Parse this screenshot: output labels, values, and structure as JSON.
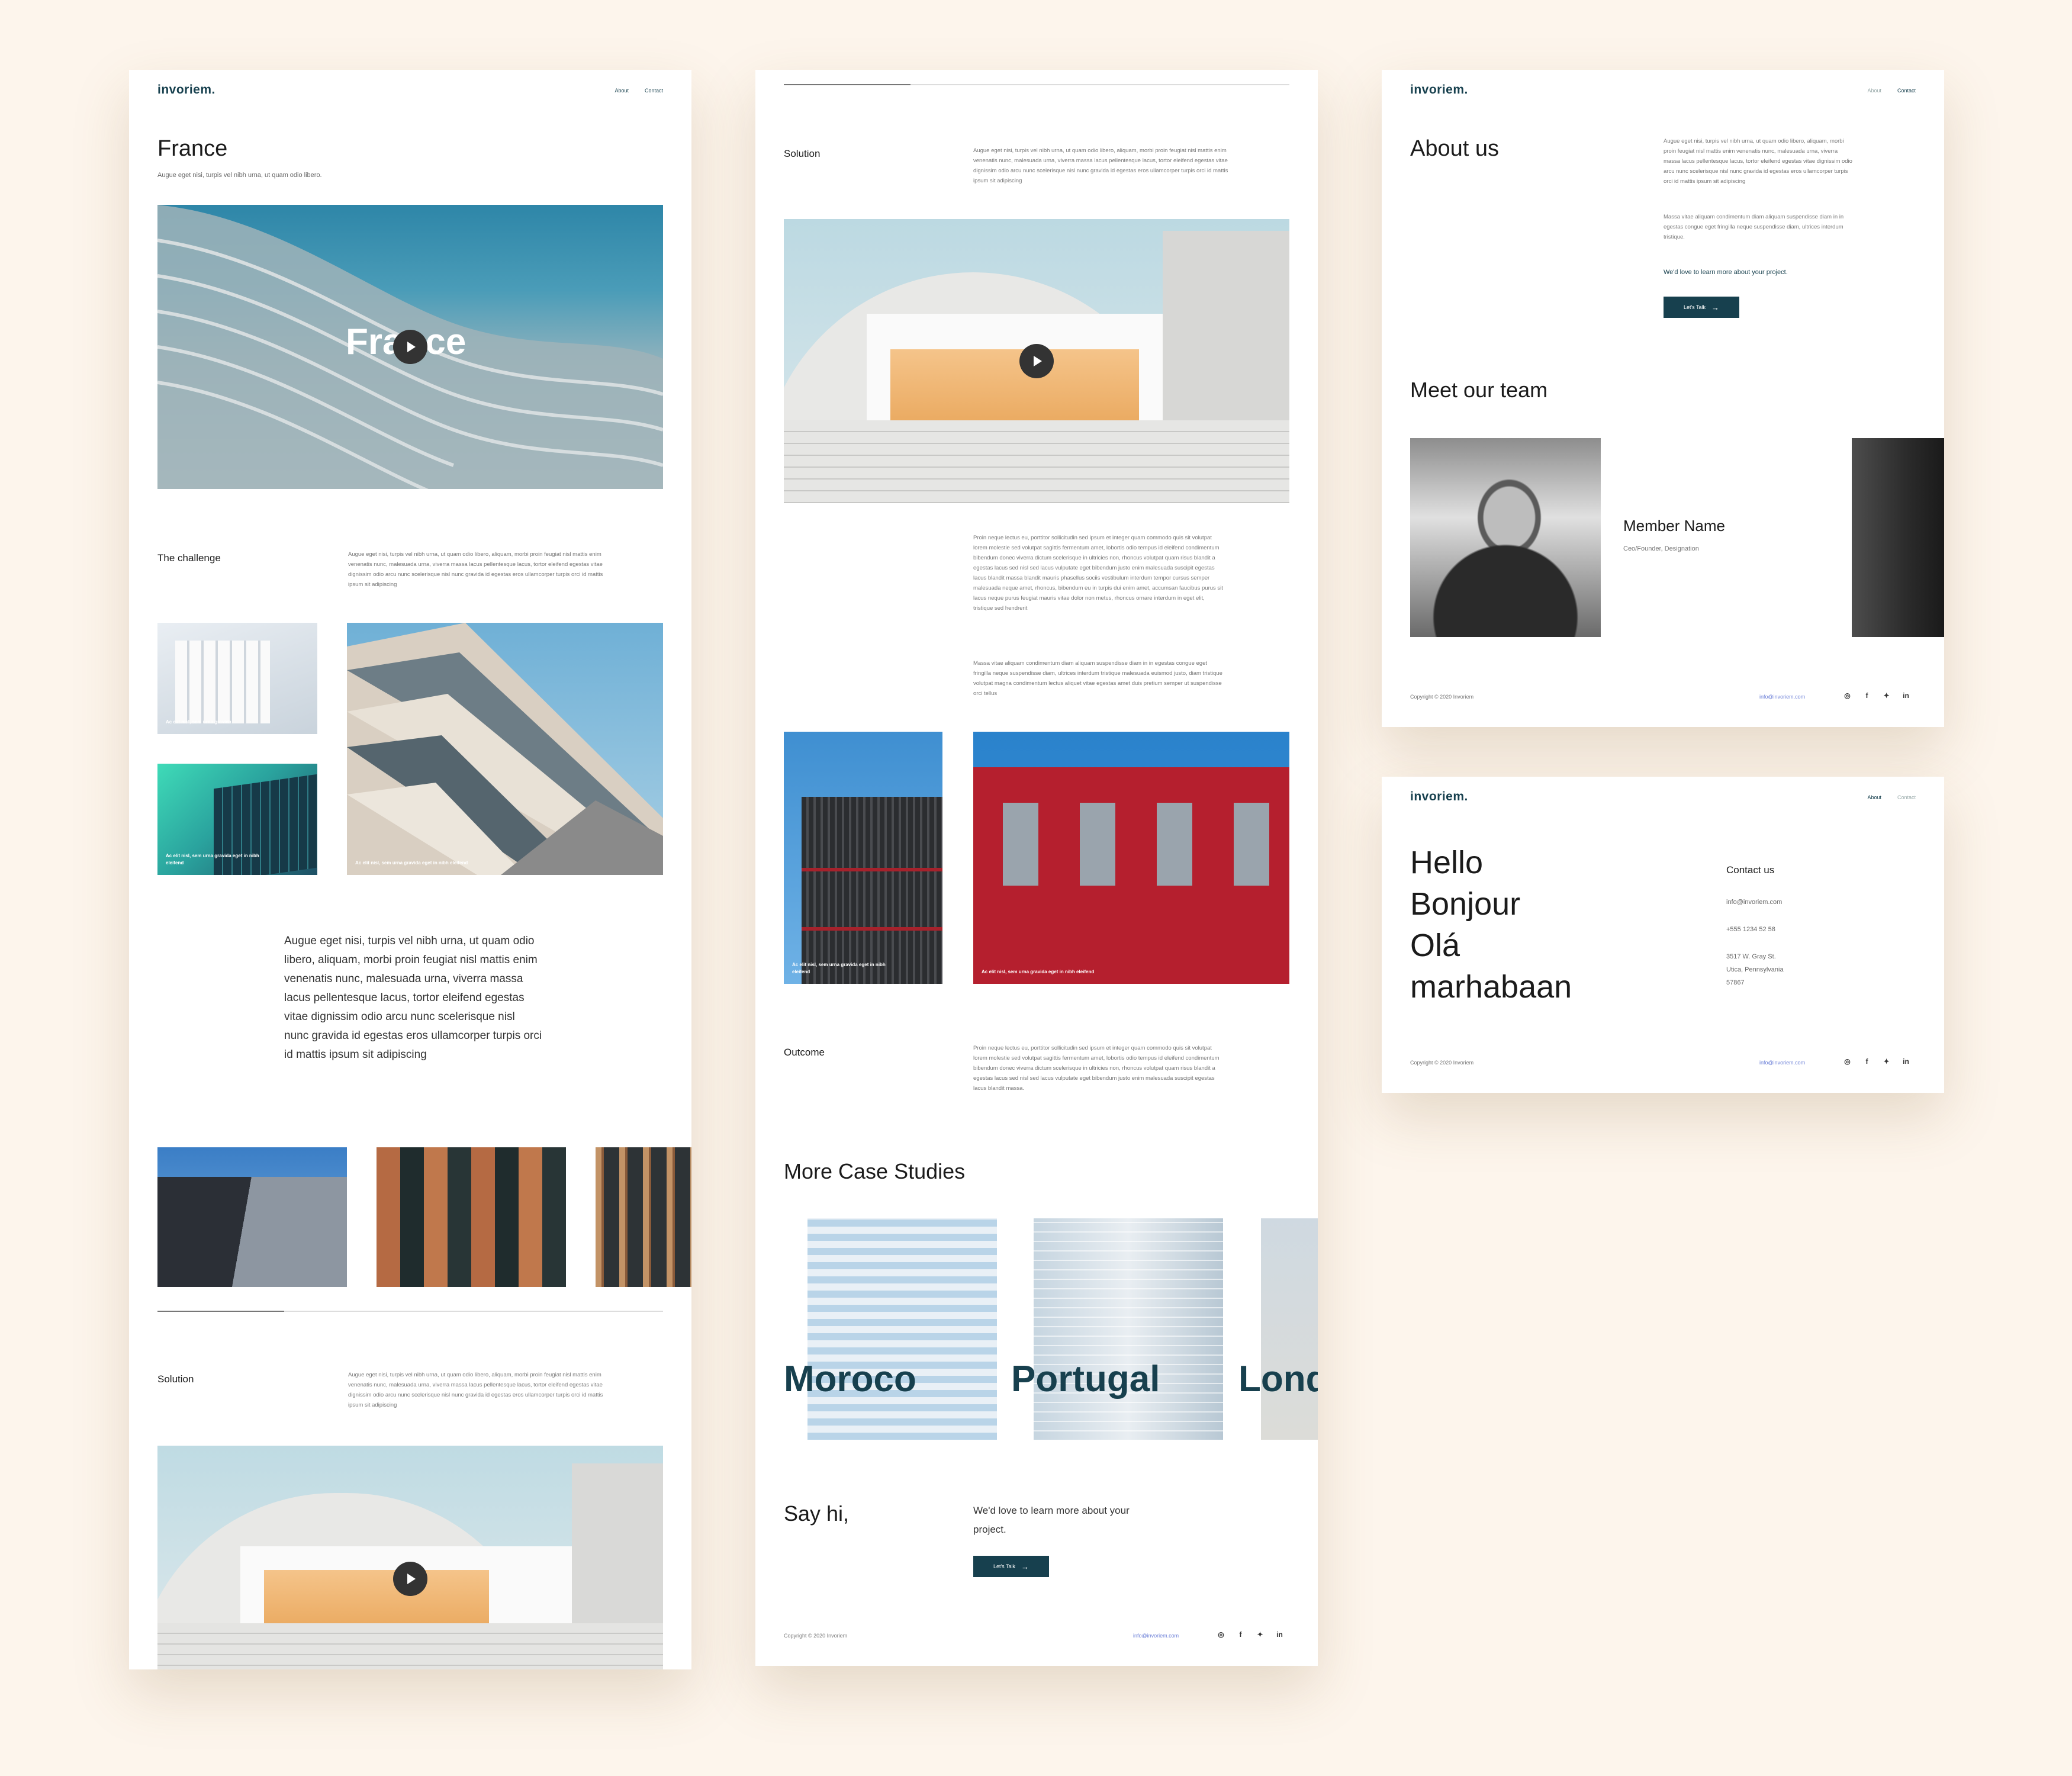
{
  "brand": {
    "logo": "invoriem."
  },
  "nav": {
    "about": "About",
    "contact": "Contact"
  },
  "page1": {
    "title": "France",
    "subtitle": "Augue eget nisi, turpis vel nibh urna, ut quam odio libero.",
    "hero_text": "France",
    "challenge_label": "The challenge",
    "lorem_short": "Augue eget nisi, turpis vel nibh urna, ut quam odio libero, aliquam, morbi proin feugiat nisl mattis enim venenatis nunc, malesuada urna, viverra massa lacus pellentesque lacus, tortor eleifend egestas vitae dignissim odio arcu nunc scelerisque nisl nunc gravida id egestas eros ullamcorper turpis orci id mattis ipsum sit adipiscing",
    "caption1": "Ac elit nisl, sem urna gravida",
    "caption2": "Ac elit nisl, sem urna gravida eget in nibh eleifend",
    "caption3": "Ac elit nisl, sem urna gravida eget in nibh eleifend",
    "quote": "Augue eget nisi, turpis vel nibh urna, ut quam odio libero, aliquam, morbi proin feugiat nisl mattis enim venenatis nunc, malesuada urna, viverra massa lacus pellentesque lacus, tortor eleifend egestas vitae dignissim odio arcu nunc scelerisque nisl nunc gravida id egestas eros ullamcorper turpis orci id mattis ipsum sit adipiscing",
    "solution_label": "Solution"
  },
  "page2": {
    "solution_label": "Solution",
    "lorem_long": "Proin neque lectus eu, porttitor sollicitudin sed ipsum et integer quam commodo quis sit volutpat lorem molestie sed volutpat sagittis fermentum amet, lobortis odio tempus id eleifend condimentum bibendum donec viverra dictum scelerisque in ultricies non, rhoncus volutpat quam risus blandit a egestas lacus sed nisl sed lacus vulputate eget bibendum justo enim malesuada suscipit egestas lacus blandit massa blandit mauris phasellus sociis vestibulum interdum tempor cursus semper malesuada neque amet, rhoncus, bibendum eu in turpis dui enim amet, accumsan faucibus purus sit lacus neque purus feugiat mauris vitae dolor non metus, rhoncus ornare interdum in eget elit, tristique sed hendrerit",
    "lorem_mid": "Massa vitae aliquam condimentum diam aliquam suspendisse diam in in egestas congue eget fringilla neque suspendisse diam, ultrices interdum tristique malesuada euismod justo, diam tristique volutpat magna condimentum lectus aliquet vitae egestas amet duis pretium semper ut suspendisse orci tellus",
    "caption_a": "Ac elit nisl, sem urna gravida eget in nibh eleifend",
    "caption_b": "Ac elit nisl, sem urna gravida eget in nibh eleifend",
    "outcome_label": "Outcome",
    "lorem_outcome": "Proin neque lectus eu, porttitor sollicitudin sed ipsum et integer quam commodo quis sit volutpat lorem molestie sed volutpat sagittis fermentum amet, lobortis odio tempus id eleifend condimentum bibendum donec viverra dictum scelerisque in ultricies non, rhoncus volutpat quam risus blandit a egestas lacus sed nisl sed lacus vulputate eget bibendum justo enim malesuada suscipit egestas lacus blandit massa.",
    "more_title": "More Case Studies",
    "cities": [
      "Moroco",
      "Portugal",
      "London"
    ],
    "say_hi": "Say hi,",
    "learn_more": "We'd love to learn more about your project.",
    "cta": "Let's Talk",
    "copyright": "Copyright © 2020 Invoriem",
    "email": "info@invoriem.com"
  },
  "page3": {
    "title": "About us",
    "p1": "Augue eget nisi, turpis vel nibh urna, ut quam odio libero, aliquam, morbi proin feugiat nisl mattis enim venenatis nunc, malesuada urna, viverra massa lacus pellentesque lacus, tortor eleifend egestas vitae dignissim odio arcu nunc scelerisque nisl nunc gravida id egestas eros ullamcorper turpis orci id mattis ipsum sit adipiscing",
    "p2": "Massa vitae aliquam condimentum diam aliquam suspendisse diam in in egestas congue eget fringilla neque suspendisse diam, ultrices interdum tristique.",
    "learn_more": "We'd love to learn more about your project.",
    "cta": "Let's Talk",
    "team_title": "Meet our team",
    "member_name": "Member Name",
    "member_role": "Ceo/Founder, Designation",
    "copyright": "Copyright © 2020 Invoriem",
    "email": "info@invoriem.com"
  },
  "page4": {
    "greetings": [
      "Hello",
      "Bonjour",
      "Olá",
      "marhabaan"
    ],
    "contact_label": "Contact us",
    "email": "info@invoriem.com",
    "phone": "+555 1234 52 58",
    "address1": "3517 W. Gray St.",
    "address2": "Utica, Pennsylvania",
    "zip": "57867",
    "copyright": "Copyright © 2020 Invoriem",
    "footer_email": "info@invoriem.com"
  },
  "social_icons": [
    "instagram-icon",
    "facebook-icon",
    "twitter-icon",
    "linkedin-icon"
  ],
  "colors": {
    "accent": "#17404e",
    "background": "#fdf5ec",
    "link": "#6b7fd7"
  }
}
